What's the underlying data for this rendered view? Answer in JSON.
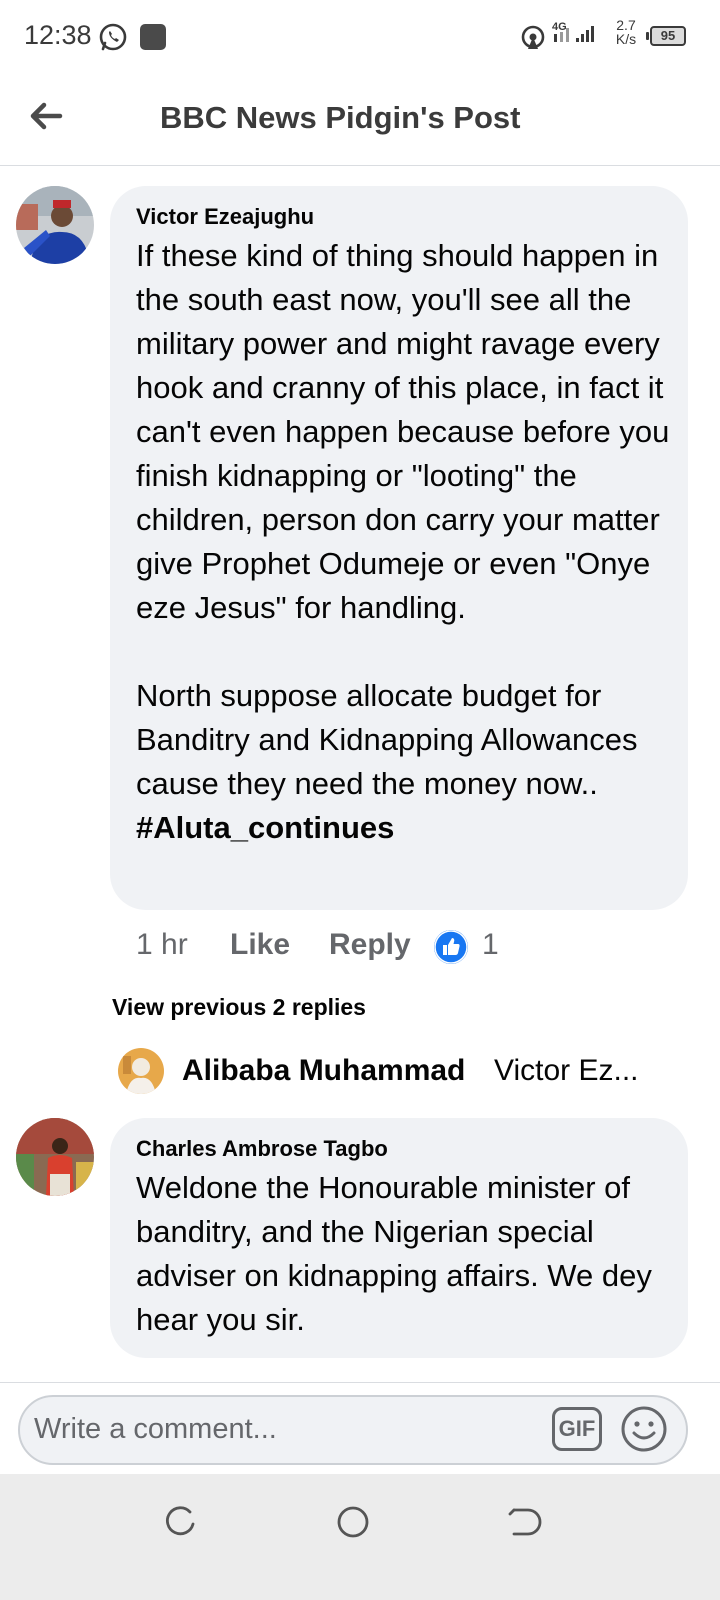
{
  "status_bar": {
    "time": "12:38",
    "network": "4G",
    "speed_value": "2.7",
    "speed_unit": "K/s",
    "battery": "95",
    "icons": [
      "whatsapp-icon",
      "notification-square-icon",
      "hotspot-icon",
      "signal-icon",
      "battery-icon"
    ]
  },
  "header": {
    "title": "BBC News Pidgin's Post",
    "back_icon": "back-arrow-icon"
  },
  "comments": [
    {
      "author": "Victor Ezeajughu",
      "text": "If these kind of thing should happen in the south east now, you'll see all the military power and might ravage every hook and cranny of this place, in fact it can't even happen because before you finish kidnapping or \"looting\" the children, person don carry your matter give Prophet Odumeje or even \"Onye eze Jesus\" for handling.\n\nNorth suppose allocate budget for Banditry and Kidnapping Allowances cause they need the money now.. ",
      "hashtag": "#Aluta_continues",
      "time": "1 hr",
      "like_label": "Like",
      "reply_label": "Reply",
      "reaction_count": "1",
      "view_previous": "View previous 2 replies",
      "latest_reply": {
        "name": "Alibaba Muhammad",
        "snippet": "Victor Ez..."
      }
    },
    {
      "author": "Charles Ambrose Tagbo",
      "text": "Weldone the Honourable minister of banditry, and the Nigerian special adviser on kidnapping affairs. We dey hear you sir."
    }
  ],
  "composer": {
    "placeholder": "Write a comment...",
    "gif_label": "GIF",
    "emoji_icon": "emoji-icon"
  },
  "nav_bar": {
    "icons": [
      "recent-apps-icon",
      "home-icon",
      "back-icon"
    ]
  },
  "colors": {
    "bubble": "#f0f2f5",
    "meta_text": "#65676b",
    "like_blue": "#1877f2"
  }
}
